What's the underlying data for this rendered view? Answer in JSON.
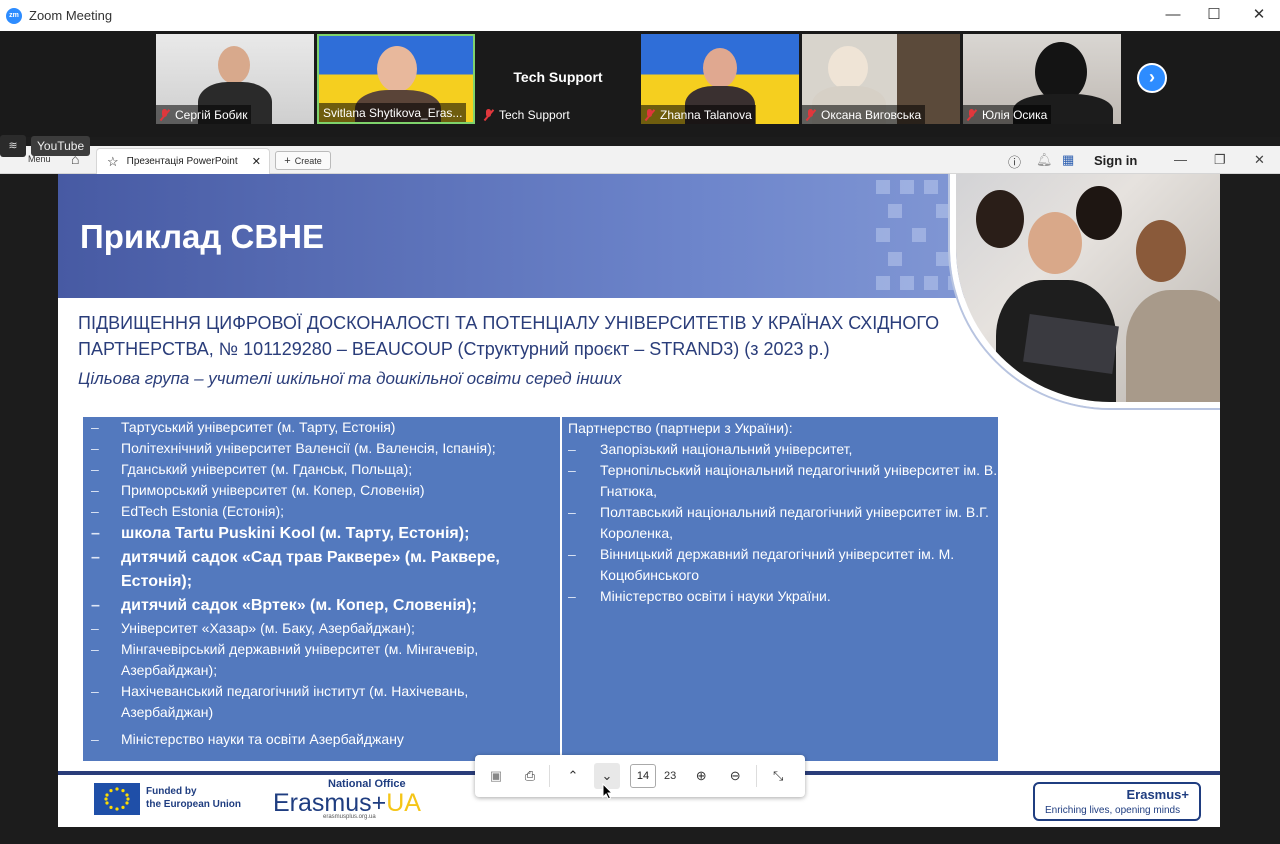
{
  "window": {
    "title": "Zoom Meeting",
    "logo_text": "zm",
    "controls": {
      "minimize": "—",
      "maximize": "☐",
      "close": "✕"
    }
  },
  "participants": [
    {
      "name": "Сергій Бобик"
    },
    {
      "name": "Svitlana Shytikova_Eras..."
    },
    {
      "name": "Tech Support",
      "display": "Tech Support"
    },
    {
      "name": "Zhanna Talanova"
    },
    {
      "name": "Оксана Виговська"
    },
    {
      "name": "Юлія Осика"
    }
  ],
  "youtube_badge": "YouTube",
  "browser": {
    "menu_label": "Menu",
    "tab_title": "Презентація PowerPoint",
    "tab_close": "✕",
    "create_label": "Create",
    "create_plus": "+",
    "signin_label": "Sign in"
  },
  "slide": {
    "title": "Приклад CBHE",
    "heading": "ПІДВИЩЕННЯ ЦИФРОВОЇ ДОСКОНАЛОСТІ ТА ПОТЕНЦІАЛУ УНІВЕРСИТЕТІВ У КРАЇНАХ СХІДНОГО ПАРТНЕРСТВА, № 101129280 – BEAUCOUP (Структурний проєкт – STRAND3) (з 2023 р.)",
    "subheading": "Цільова група – учителі шкільної та дошкільної освіти серед інших",
    "left_items": [
      {
        "text": "Тартуський університет (м. Тарту, Естонія)",
        "bold": false
      },
      {
        "text": "Політехнічний університет Валенсії (м. Валенсія, Іспанія);",
        "bold": false
      },
      {
        "text": "Гданський університет (м. Гданськ, Польща);",
        "bold": false
      },
      {
        "text": "Приморський університет (м. Копер, Словенія)",
        "bold": false
      },
      {
        "text": "EdTech Estonia (Естонія);",
        "bold": false
      },
      {
        "text": "школа Tartu Puskini Kool (м. Тарту, Естонія);",
        "bold": true
      },
      {
        "text": "дитячий садок «Сад трав Раквере» (м. Раквере, Естонія);",
        "bold": true
      },
      {
        "text": "дитячий садок «Вртек» (м. Копер, Словенія);",
        "bold": true
      },
      {
        "text": "Університет «Хазар» (м. Баку, Азербайджан);",
        "bold": false
      },
      {
        "text": "Мінгачевірський державний університет (м. Мінгачевір, Азербайджан);",
        "bold": false
      },
      {
        "text": "Нахічеванський педагогічний інститут (м. Нахічевань, Азербайджан)",
        "bold": false
      },
      {
        "text": "Міністерство науки та освіти Азербайджану",
        "bold": false
      }
    ],
    "right_header": "Партнерство (партнери з України):",
    "right_items": [
      {
        "text": "Запорізький національний університет,"
      },
      {
        "text": "Тернопільський національний педагогічний університет ім. В. Гнатюка,"
      },
      {
        "text": "Полтавський національний педагогічний університет ім. В.Г. Короленка,"
      },
      {
        "text": "Вінницький державний педагогічний університет ім. М. Коцюбинського"
      },
      {
        "text": "Міністерство освіти і науки України."
      }
    ],
    "dash": "–",
    "footer": {
      "eu_line1": "Funded by",
      "eu_line2": "the European Union",
      "national_office": "National Office",
      "erasmus_word": "Erasmus+",
      "erasmus_ua": "UA",
      "erasmus_url": "erasmusplus.org.ua",
      "badge_title": "Erasmus+",
      "badge_sub": "Enriching lives, opening minds"
    }
  },
  "pdf_toolbar": {
    "current_page": "14",
    "total_pages": "23"
  },
  "colors": {
    "accent_blue": "#2d8cff",
    "slide_navy": "#2a3d7a",
    "table_blue": "#5379be"
  }
}
